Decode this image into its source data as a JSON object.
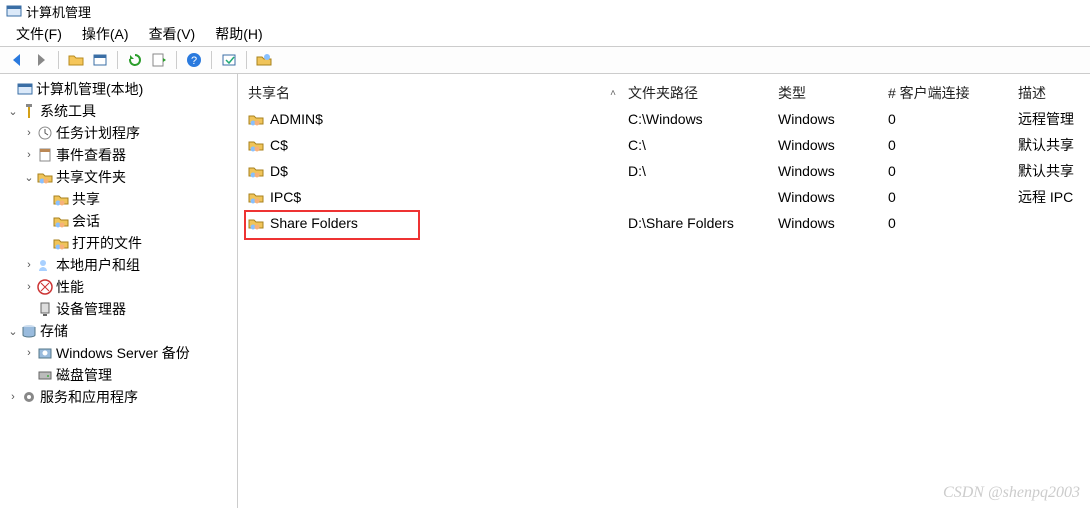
{
  "title": "计算机管理",
  "menu": {
    "file": "文件(F)",
    "action": "操作(A)",
    "view": "查看(V)",
    "help": "帮助(H)"
  },
  "tree": {
    "root": "计算机管理(本地)",
    "system_tools": "系统工具",
    "task_scheduler": "任务计划程序",
    "event_viewer": "事件查看器",
    "shared_folders": "共享文件夹",
    "shares": "共享",
    "sessions": "会话",
    "open_files": "打开的文件",
    "local_users": "本地用户和组",
    "performance": "性能",
    "device_manager": "设备管理器",
    "storage": "存储",
    "ws_backup": "Windows Server 备份",
    "disk_mgmt": "磁盘管理",
    "services_apps": "服务和应用程序"
  },
  "columns": {
    "share_name": "共享名",
    "folder_path": "文件夹路径",
    "type": "类型",
    "client_conn": "# 客户端连接",
    "description": "描述"
  },
  "rows": [
    {
      "name": "ADMIN$",
      "path": "C:\\Windows",
      "type": "Windows",
      "conn": "0",
      "desc": "远程管理"
    },
    {
      "name": "C$",
      "path": "C:\\",
      "type": "Windows",
      "conn": "0",
      "desc": "默认共享"
    },
    {
      "name": "D$",
      "path": "D:\\",
      "type": "Windows",
      "conn": "0",
      "desc": "默认共享"
    },
    {
      "name": "IPC$",
      "path": "",
      "type": "Windows",
      "conn": "0",
      "desc": "远程 IPC"
    },
    {
      "name": "Share Folders",
      "path": "D:\\Share Folders",
      "type": "Windows",
      "conn": "0",
      "desc": ""
    }
  ],
  "watermark": "CSDN @shenpq2003"
}
